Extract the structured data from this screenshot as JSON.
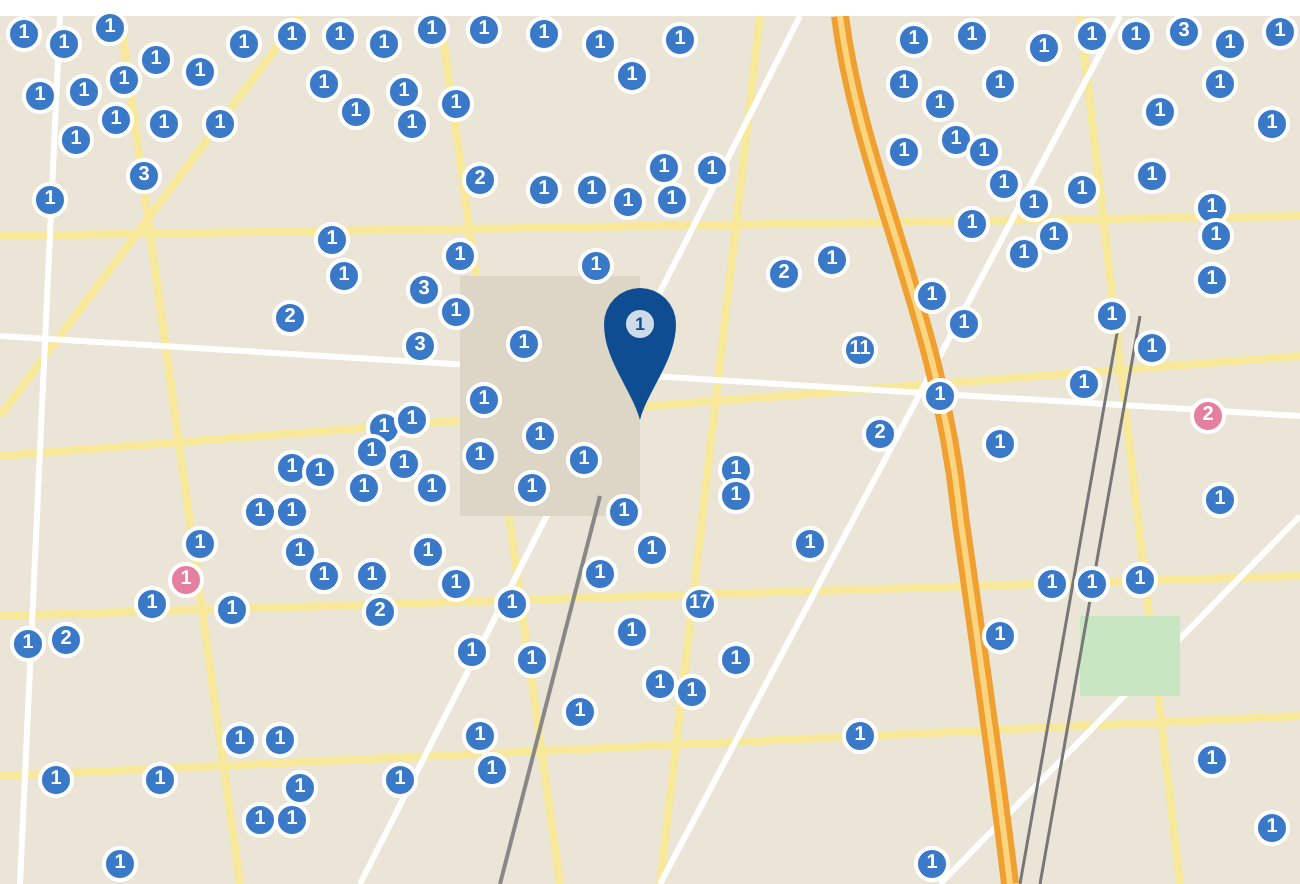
{
  "pin": {
    "label": "1"
  },
  "markers": [
    {
      "count": "1",
      "color": "#3a78c8"
    },
    {
      "count": "1",
      "color": "#3a78c8"
    },
    {
      "count": "1",
      "color": "#3a78c8"
    },
    {
      "count": "1",
      "color": "#3a78c8"
    },
    {
      "count": "1",
      "color": "#3a78c8"
    },
    {
      "count": "1",
      "color": "#3a78c8"
    },
    {
      "count": "1",
      "color": "#3a78c8"
    },
    {
      "count": "1",
      "color": "#3a78c8"
    },
    {
      "count": "1",
      "color": "#3a78c8"
    },
    {
      "count": "1",
      "color": "#3a78c8"
    },
    {
      "count": "1",
      "color": "#3a78c8"
    },
    {
      "count": "1",
      "color": "#3a78c8"
    },
    {
      "count": "1",
      "color": "#3a78c8"
    },
    {
      "count": "1",
      "color": "#3a78c8"
    },
    {
      "count": "1",
      "color": "#3a78c8"
    },
    {
      "count": "1",
      "color": "#3a78c8"
    },
    {
      "count": "3",
      "color": "#3a78c8"
    },
    {
      "count": "1",
      "color": "#3a78c8"
    },
    {
      "count": "1",
      "color": "#3a78c8"
    },
    {
      "count": "1",
      "color": "#3a78c8"
    },
    {
      "count": "1",
      "color": "#3a78c8"
    },
    {
      "count": "1",
      "color": "#3a78c8"
    },
    {
      "count": "1",
      "color": "#3a78c8"
    },
    {
      "count": "1",
      "color": "#3a78c8"
    },
    {
      "count": "1",
      "color": "#3a78c8"
    },
    {
      "count": "1",
      "color": "#3a78c8"
    },
    {
      "count": "1",
      "color": "#3a78c8"
    },
    {
      "count": "1",
      "color": "#3a78c8"
    },
    {
      "count": "1",
      "color": "#3a78c8"
    },
    {
      "count": "1",
      "color": "#3a78c8"
    },
    {
      "count": "1",
      "color": "#3a78c8"
    },
    {
      "count": "1",
      "color": "#3a78c8"
    },
    {
      "count": "1",
      "color": "#3a78c8"
    },
    {
      "count": "1",
      "color": "#3a78c8"
    },
    {
      "count": "1",
      "color": "#3a78c8"
    },
    {
      "count": "1",
      "color": "#3a78c8"
    },
    {
      "count": "1",
      "color": "#3a78c8"
    },
    {
      "count": "1",
      "color": "#3a78c8"
    },
    {
      "count": "1",
      "color": "#3a78c8"
    },
    {
      "count": "1",
      "color": "#3a78c8"
    },
    {
      "count": "1",
      "color": "#3a78c8"
    },
    {
      "count": "1",
      "color": "#3a78c8"
    },
    {
      "count": "1",
      "color": "#3a78c8"
    },
    {
      "count": "1",
      "color": "#3a78c8"
    },
    {
      "count": "3",
      "color": "#3a78c8"
    },
    {
      "count": "2",
      "color": "#3a78c8"
    },
    {
      "count": "1",
      "color": "#3a78c8"
    },
    {
      "count": "1",
      "color": "#3a78c8"
    },
    {
      "count": "1",
      "color": "#3a78c8"
    },
    {
      "count": "1",
      "color": "#3a78c8"
    },
    {
      "count": "1",
      "color": "#3a78c8"
    },
    {
      "count": "1",
      "color": "#3a78c8"
    },
    {
      "count": "1",
      "color": "#3a78c8"
    },
    {
      "count": "1",
      "color": "#3a78c8"
    },
    {
      "count": "1",
      "color": "#3a78c8"
    },
    {
      "count": "1",
      "color": "#3a78c8"
    },
    {
      "count": "1",
      "color": "#3a78c8"
    },
    {
      "count": "1",
      "color": "#3a78c8"
    },
    {
      "count": "1",
      "color": "#3a78c8"
    },
    {
      "count": "1",
      "color": "#3a78c8"
    },
    {
      "count": "1",
      "color": "#3a78c8"
    },
    {
      "count": "1",
      "color": "#3a78c8"
    },
    {
      "count": "1",
      "color": "#3a78c8"
    },
    {
      "count": "1",
      "color": "#3a78c8"
    },
    {
      "count": "1",
      "color": "#3a78c8"
    },
    {
      "count": "1",
      "color": "#3a78c8"
    },
    {
      "count": "1",
      "color": "#3a78c8"
    },
    {
      "count": "3",
      "color": "#3a78c8"
    },
    {
      "count": "2",
      "color": "#3a78c8"
    },
    {
      "count": "1",
      "color": "#3a78c8"
    },
    {
      "count": "1",
      "color": "#3a78c8"
    },
    {
      "count": "1",
      "color": "#3a78c8"
    },
    {
      "count": "2",
      "color": "#3a78c8"
    },
    {
      "count": "1",
      "color": "#3a78c8"
    },
    {
      "count": "1",
      "color": "#3a78c8"
    },
    {
      "count": "3",
      "color": "#3a78c8"
    },
    {
      "count": "1",
      "color": "#3a78c8"
    },
    {
      "count": "11",
      "color": "#3a78c8"
    },
    {
      "count": "1",
      "color": "#3a78c8"
    },
    {
      "count": "1",
      "color": "#3a78c8"
    },
    {
      "count": "1",
      "color": "#3a78c8"
    },
    {
      "count": "1",
      "color": "#3a78c8"
    },
    {
      "count": "1",
      "color": "#3a78c8"
    },
    {
      "count": "1",
      "color": "#3a78c8"
    },
    {
      "count": "2",
      "color": "#3a78c8"
    },
    {
      "count": "2",
      "color": "#e57fa0"
    },
    {
      "count": "1",
      "color": "#3a78c8"
    },
    {
      "count": "1",
      "color": "#3a78c8"
    },
    {
      "count": "1",
      "color": "#3a78c8"
    },
    {
      "count": "1",
      "color": "#3a78c8"
    },
    {
      "count": "1",
      "color": "#3a78c8"
    },
    {
      "count": "1",
      "color": "#3a78c8"
    },
    {
      "count": "1",
      "color": "#3a78c8"
    },
    {
      "count": "1",
      "color": "#3a78c8"
    },
    {
      "count": "1",
      "color": "#3a78c8"
    },
    {
      "count": "1",
      "color": "#3a78c8"
    },
    {
      "count": "1",
      "color": "#3a78c8"
    },
    {
      "count": "1",
      "color": "#3a78c8"
    },
    {
      "count": "1",
      "color": "#3a78c8"
    },
    {
      "count": "1",
      "color": "#3a78c8"
    },
    {
      "count": "1",
      "color": "#3a78c8"
    },
    {
      "count": "1",
      "color": "#3a78c8"
    },
    {
      "count": "1",
      "color": "#3a78c8"
    },
    {
      "count": "1",
      "color": "#3a78c8"
    },
    {
      "count": "1",
      "color": "#3a78c8"
    },
    {
      "count": "1",
      "color": "#3a78c8"
    },
    {
      "count": "1",
      "color": "#3a78c8"
    },
    {
      "count": "1",
      "color": "#3a78c8"
    },
    {
      "count": "1",
      "color": "#e57fa0"
    },
    {
      "count": "1",
      "color": "#3a78c8"
    },
    {
      "count": "1",
      "color": "#3a78c8"
    },
    {
      "count": "1",
      "color": "#3a78c8"
    },
    {
      "count": "1",
      "color": "#3a78c8"
    },
    {
      "count": "1",
      "color": "#3a78c8"
    },
    {
      "count": "1",
      "color": "#3a78c8"
    },
    {
      "count": "1",
      "color": "#3a78c8"
    },
    {
      "count": "1",
      "color": "#3a78c8"
    },
    {
      "count": "1",
      "color": "#3a78c8"
    },
    {
      "count": "2",
      "color": "#3a78c8"
    },
    {
      "count": "1",
      "color": "#3a78c8"
    },
    {
      "count": "17",
      "color": "#3a78c8"
    },
    {
      "count": "1",
      "color": "#3a78c8"
    },
    {
      "count": "2",
      "color": "#3a78c8"
    },
    {
      "count": "1",
      "color": "#3a78c8"
    },
    {
      "count": "1",
      "color": "#3a78c8"
    },
    {
      "count": "1",
      "color": "#3a78c8"
    },
    {
      "count": "1",
      "color": "#3a78c8"
    },
    {
      "count": "1",
      "color": "#3a78c8"
    },
    {
      "count": "1",
      "color": "#3a78c8"
    },
    {
      "count": "1",
      "color": "#3a78c8"
    },
    {
      "count": "1",
      "color": "#3a78c8"
    },
    {
      "count": "1",
      "color": "#3a78c8"
    },
    {
      "count": "1",
      "color": "#3a78c8"
    },
    {
      "count": "1",
      "color": "#3a78c8"
    },
    {
      "count": "1",
      "color": "#3a78c8"
    },
    {
      "count": "1",
      "color": "#3a78c8"
    },
    {
      "count": "1",
      "color": "#3a78c8"
    },
    {
      "count": "1",
      "color": "#3a78c8"
    },
    {
      "count": "1",
      "color": "#3a78c8"
    },
    {
      "count": "1",
      "color": "#3a78c8"
    },
    {
      "count": "1",
      "color": "#3a78c8"
    },
    {
      "count": "1",
      "color": "#3a78c8"
    },
    {
      "count": "1",
      "color": "#3a78c8"
    },
    {
      "count": "1",
      "color": "#3a78c8"
    },
    {
      "count": "1",
      "color": "#3a78c8"
    },
    {
      "count": "1",
      "color": "#3a78c8"
    }
  ]
}
